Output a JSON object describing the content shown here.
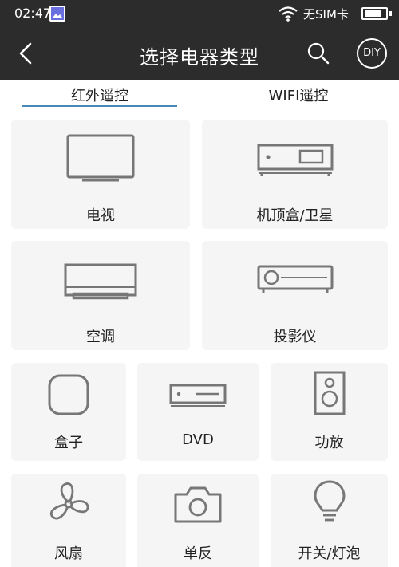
{
  "status_bar": {
    "time": "02:47",
    "carrier": "无SIM卡",
    "battery_level": 0.85,
    "icons": [
      "gallery-icon",
      "wifi-icon",
      "battery-icon"
    ]
  },
  "header": {
    "title": "选择电器类型",
    "diy_label": "DIY",
    "icons": [
      "back-arrow-icon",
      "search-icon"
    ],
    "background": "#2c2c2c"
  },
  "tabs": [
    {
      "label": "红外遥控",
      "active": true
    },
    {
      "label": "WIFI遥控",
      "active": false
    }
  ],
  "accent_color": "#4a88b8",
  "devices": [
    {
      "label": "电视",
      "icon": "tv-icon"
    },
    {
      "label": "机顶盒/卫星",
      "icon": "set-top-box-icon"
    },
    {
      "label": "空调",
      "icon": "air-conditioner-icon"
    },
    {
      "label": "投影仪",
      "icon": "projector-icon"
    },
    {
      "label": "盒子",
      "icon": "box-icon"
    },
    {
      "label": "DVD",
      "icon": "dvd-icon"
    },
    {
      "label": "功放",
      "icon": "speaker-icon"
    },
    {
      "label": "风扇",
      "icon": "fan-icon"
    },
    {
      "label": "单反",
      "icon": "camera-icon"
    },
    {
      "label": "开关/灯泡",
      "icon": "lightbulb-icon"
    }
  ]
}
